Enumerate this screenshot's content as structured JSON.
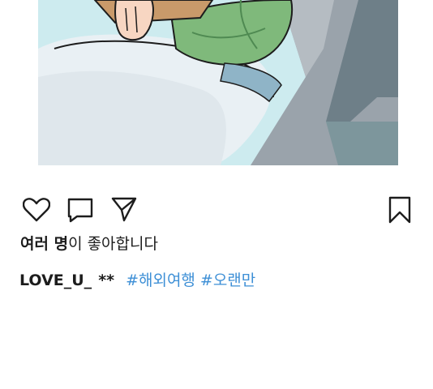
{
  "post": {
    "likes_bold": "여러 명",
    "likes_suffix": "이 좋아합니다",
    "username": "LOVE_U_",
    "stars": "**",
    "hashtags": [
      "#해외여행",
      "#오랜만"
    ]
  },
  "icons": {
    "like": "heart-outline-icon",
    "comment": "speech-bubble-icon",
    "share": "paper-plane-icon",
    "bookmark": "bookmark-outline-icon"
  },
  "colors": {
    "hashtag": "#3d8fd6",
    "text": "#1c1c1c",
    "image_sky": "#bde2ea",
    "image_sleeve": "#7fb97b",
    "image_pillow": "#e6edf2"
  }
}
